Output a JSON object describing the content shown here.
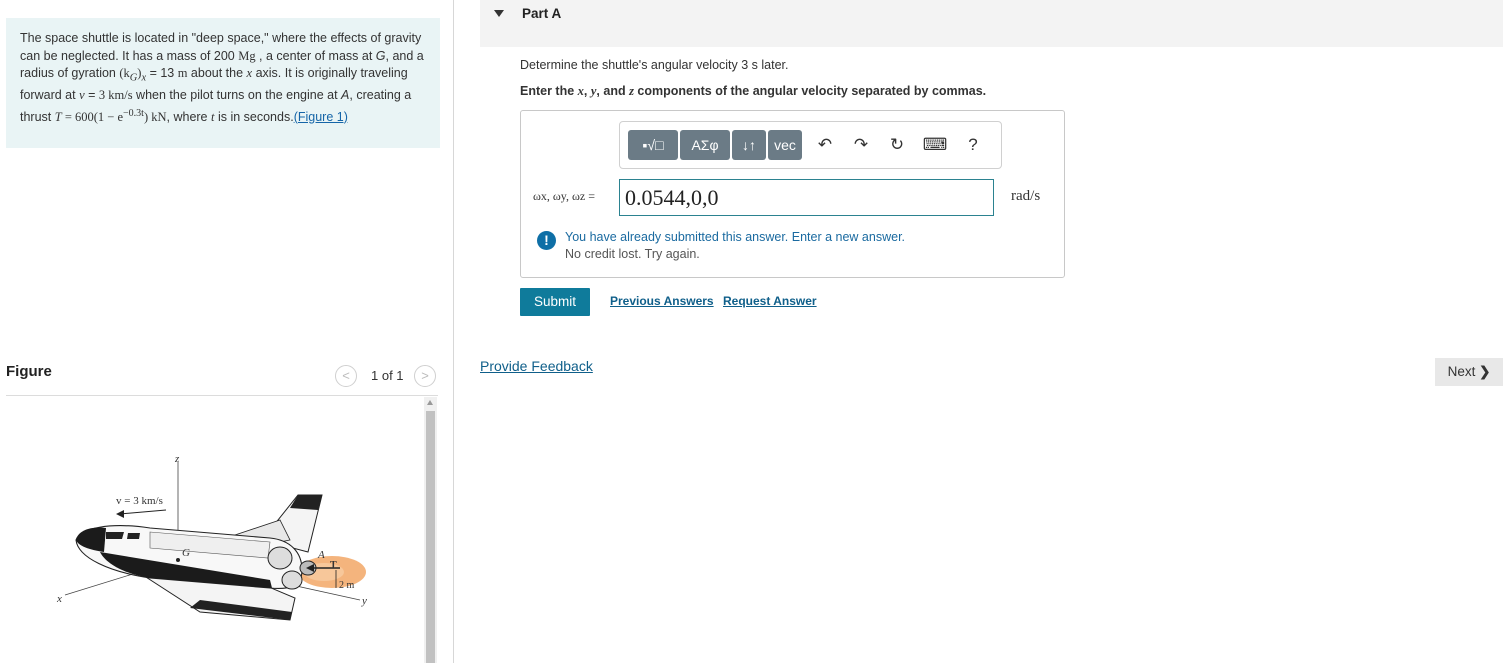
{
  "problem": {
    "s1": "The space shuttle is located in \"deep space,\" where the effects of gravity can be neglected. It has a mass of 200 ",
    "mass_unit": "Mg",
    "s2": " , a center of mass at ",
    "g": "G",
    "s3": ", and a radius of gyration ",
    "k_sym": "(k",
    "k_sub": "G",
    "k_close": ")",
    "k_x": "x",
    "s4": " = 13 ",
    "m": "m",
    "s5": " about the ",
    "x": "x",
    "s6": " axis. It is originally traveling forward at ",
    "v": "v",
    "s7": " = ",
    "speed": "3 km/s",
    "s8": " when the pilot turns on the engine at ",
    "a": "A",
    "s9": ", creating a thrust ",
    "t_sym": "T",
    "thrust_expr": " = 600(1 − e",
    "thrust_exp": "−0.3t",
    "thrust_close": ") kN",
    "s10": ", where ",
    "t": "t",
    "s11": " is in seconds.",
    "figure_link": "(Figure 1)"
  },
  "figure": {
    "title": "Figure",
    "counter": "1 of 1",
    "prev_icon": "chevron-left-icon",
    "next_icon": "chevron-right-icon",
    "labels": {
      "z": "z",
      "x": "x",
      "y": "y",
      "v": "v = 3 km/s",
      "g": "G",
      "a": "A",
      "t": "T",
      "dist": "2 m"
    }
  },
  "part": {
    "title": "Part A",
    "question": "Determine the shuttle's angular velocity 3 s later.",
    "instruction_pre": "Enter the ",
    "ix": "x",
    "sep1": ", ",
    "iy": "y",
    "sep2": ", and ",
    "iz": "z",
    "instruction_post": " components of the angular velocity separated by commas."
  },
  "toolbar": {
    "templates_label": "▪√□",
    "greek_label": "ΑΣφ",
    "arrows_label": "↓↑",
    "vec_label": "vec",
    "undo_icon": "↶",
    "redo_icon": "↷",
    "reset_icon": "↻",
    "keyboard_icon": "⌨",
    "help_label": "?"
  },
  "answer": {
    "label": "ωx, ωy, ωz =",
    "value": "0.0544,0,0",
    "unit": "rad/s"
  },
  "feedback": {
    "line1": "You have already submitted this answer. Enter a new answer.",
    "line2": "No credit lost. Try again.",
    "icon": "!"
  },
  "actions": {
    "submit": "Submit",
    "previous_answers": "Previous Answers",
    "request_answer": "Request Answer",
    "provide_feedback": "Provide Feedback",
    "next": "Next"
  }
}
